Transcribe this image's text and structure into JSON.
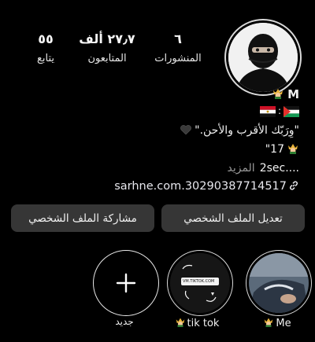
{
  "stats": {
    "posts": {
      "count": "٦",
      "label": "المنشورات"
    },
    "followers": {
      "count": "٢٧٫٧ ألف",
      "label": "المتابعون"
    },
    "following": {
      "count": "٥٥",
      "label": "يتابع"
    }
  },
  "bio": {
    "name": "M",
    "quote": "\"وِرَبّك الأقرب والأحن.\"",
    "age_line": "\"17",
    "more_prefix": "2sec....",
    "more_label": "المزيد",
    "link": "sarhne.com.30290387714517"
  },
  "buttons": {
    "edit": "تعديل الملف الشخصي",
    "share": "مشاركة الملف الشخصي"
  },
  "highlights": [
    {
      "label": "جديد"
    },
    {
      "label": "tik tok",
      "badge_text": "VM.TIKTOK.COM"
    },
    {
      "label": "Me"
    }
  ],
  "colors": {
    "background": "#000000",
    "button_bg": "#363636",
    "muted_text": "#9a9a9a"
  },
  "icons": {
    "bio_emoji": "king-emoji",
    "quote_emoji": "black-heart-emoji",
    "link": "link-icon"
  }
}
